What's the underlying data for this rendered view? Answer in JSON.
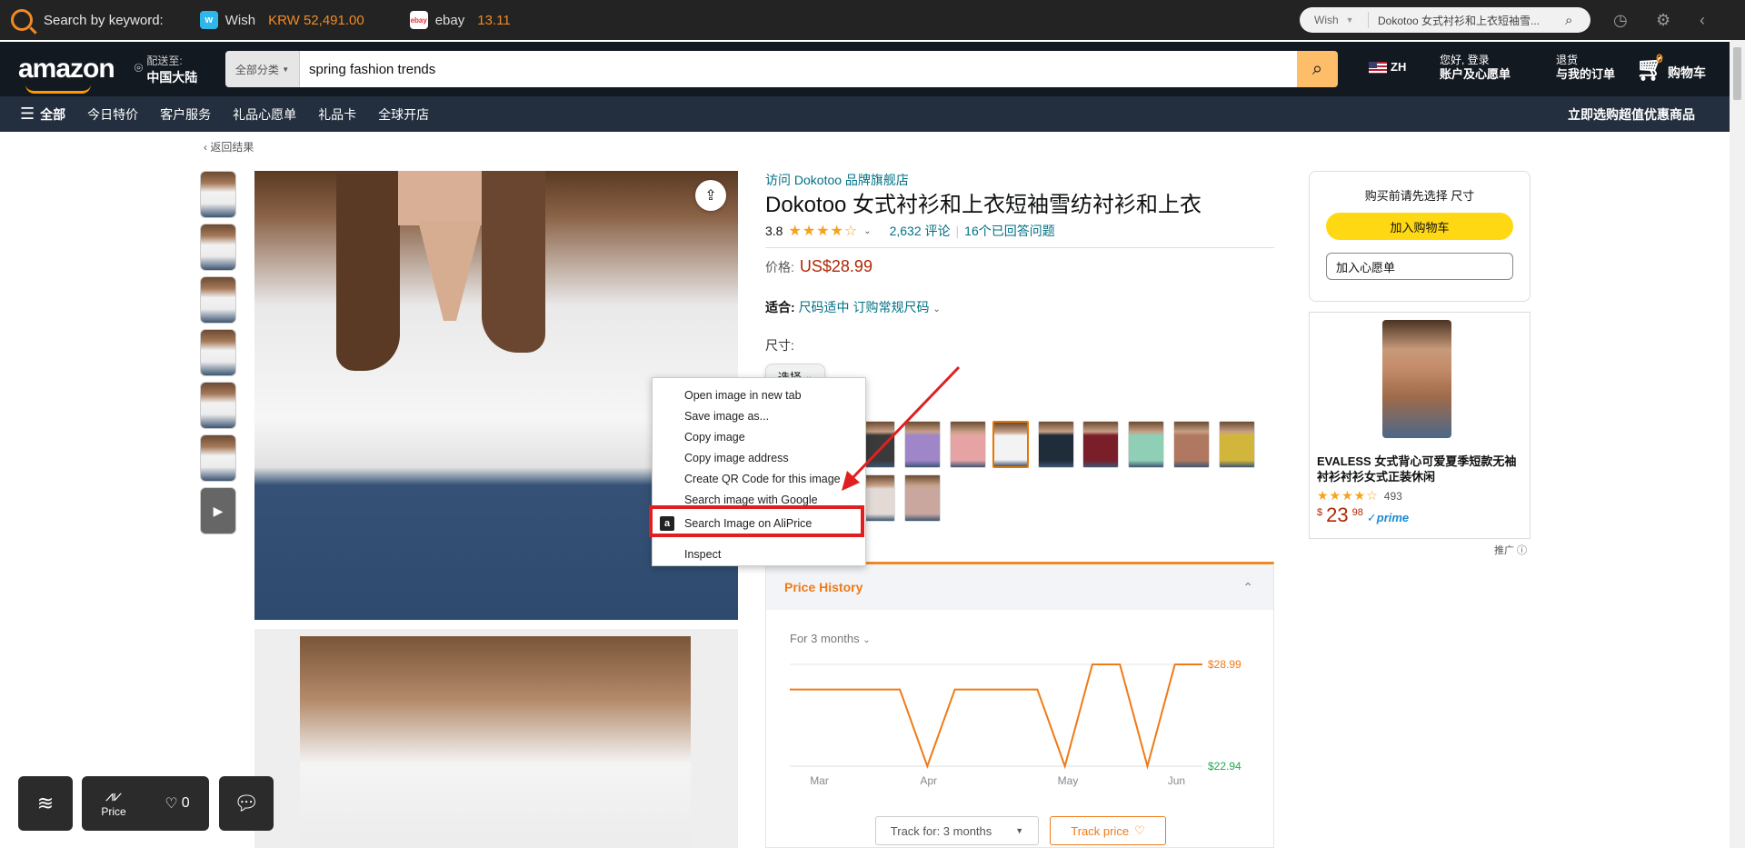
{
  "extension_bar": {
    "search_label": "Search by keyword:",
    "sites": [
      {
        "name": "Wish",
        "currency": "KRW 52,491.00",
        "icon": "wish-icon",
        "icon_letter": "w"
      },
      {
        "name": "ebay",
        "value": "13.11",
        "icon": "ebay-icon",
        "icon_letter": "ebay"
      }
    ],
    "search_site": "Wish",
    "search_query": "Dokotoo 女式衬衫和上衣短袖雪..."
  },
  "amazon_header": {
    "logo": "amazon",
    "deliver_label": "配送至:",
    "deliver_location": "中国大陆",
    "search_category": "全部分类",
    "search_value": "spring fashion trends",
    "language": "ZH",
    "account_line1": "您好, 登录",
    "account_line2": "账户及心愿单",
    "orders_line1": "退货",
    "orders_line2": "与我的订单",
    "cart_count": "0",
    "cart_label": "购物车"
  },
  "nav": {
    "items": [
      "全部",
      "今日特价",
      "客户服务",
      "礼品心愿单",
      "礼品卡",
      "全球开店"
    ],
    "promo": "立即选购超值优惠商品"
  },
  "breadcrumb": "‹ 返回结果",
  "product": {
    "store_link": "访问 Dokotoo 品牌旗舰店",
    "title": "Dokotoo 女式衬衫和上衣短袖雪纺衬衫和上衣",
    "rating": "3.8",
    "stars": "★★★★☆",
    "reviews": "2,632 评论",
    "answered": "16个已回答问题",
    "price_label": "价格:",
    "price": "US$28.99",
    "fit_label": "适合:",
    "fit_value": "尺码适中 订购常规尺码",
    "size_label": "尺寸:",
    "size_select": "选择"
  },
  "swatch_colors": [
    "#3a3a3a",
    "#9f86c9",
    "#e6a3a3",
    "#f3f3f3",
    "#1f2c3a",
    "#7a1e2a",
    "#8fcfb6",
    "#b07860",
    "#d2b63b",
    "#e3dad6",
    "#c9a79f"
  ],
  "context_menu": {
    "items": [
      "Open image in new tab",
      "Save image as...",
      "Copy image",
      "Copy image address",
      "Create QR Code for this image",
      "Search image with Google",
      "Search Image on AliPrice",
      "Inspect"
    ],
    "aliprice_icon": "a"
  },
  "price_history": {
    "title": "Price History",
    "range": "For 3 months",
    "track_for": "Track for: 3 months",
    "track_price": "Track price",
    "max_label": "$28.99",
    "min_label": "$22.94",
    "colors": {
      "accent": "#f07a16",
      "min": "#21a94b"
    }
  },
  "chart_data": {
    "type": "line",
    "title": "",
    "xlabel": "",
    "ylabel": "",
    "x_ticks": [
      "Mar",
      "Apr",
      "May",
      "Jun"
    ],
    "x": [
      "Feb 28",
      "Mar 7",
      "Mar 14",
      "Mar 21",
      "Mar 28",
      "Apr 1",
      "Apr 7",
      "Apr 14",
      "Apr 21",
      "Apr 28",
      "May 5",
      "May 12",
      "May 19",
      "May 26",
      "Jun 2",
      "Jun 9"
    ],
    "values": [
      27.5,
      27.5,
      27.5,
      27.5,
      27.5,
      22.94,
      27.5,
      27.5,
      27.5,
      27.5,
      22.94,
      28.99,
      28.99,
      22.94,
      28.99,
      28.99
    ],
    "ylim": [
      22.94,
      28.99
    ]
  },
  "buybox": {
    "heading": "购买前请先选择 尺寸",
    "add_to_cart": "加入购物车",
    "add_to_wishlist": "加入心愿单"
  },
  "ad": {
    "title": "EVALESS 女式背心可爱夏季短款无袖衬衫衬衫女式正装休闲",
    "stars": "★★★★☆",
    "reviews": "493",
    "price_dollar": "23",
    "price_cents": "98",
    "price_currency": "$",
    "prime": "✓prime",
    "ad_label": "推广 ⓘ"
  },
  "floating": {
    "price_label": "Price",
    "fav_count": "0"
  }
}
